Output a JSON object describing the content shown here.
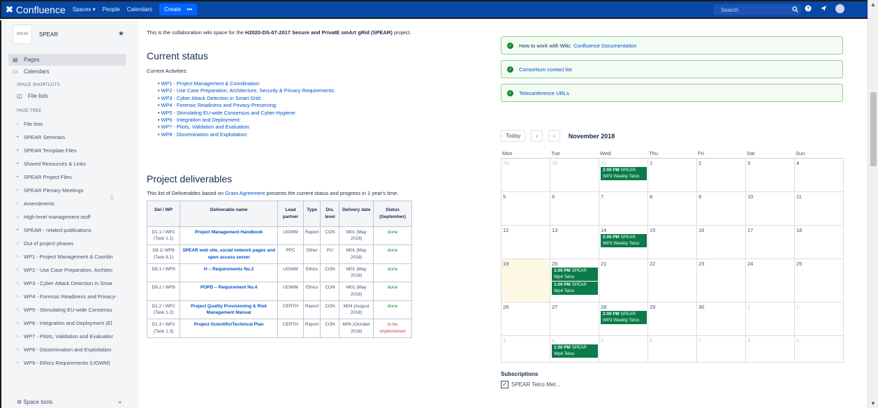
{
  "topnav": {
    "product": "Confluence",
    "items": [
      "Spaces",
      "People",
      "Calendars"
    ],
    "create_label": "Create",
    "more_label": "•••",
    "search_placeholder": "Search"
  },
  "sidebar": {
    "space_logo_text": "SPEAR",
    "space_name": "SPEAR",
    "pages_label": "Pages",
    "calendars_label": "Calendars",
    "shortcuts_header": "SPACE SHORTCUTS",
    "file_lists_shortcut": "File lists",
    "page_tree_header": "PAGE TREE",
    "tree": [
      {
        "bullet": "›",
        "label": "File lists"
      },
      {
        "bullet": "•",
        "label": "SPEAR Seminars"
      },
      {
        "bullet": "•",
        "label": "SPEAR Template Files"
      },
      {
        "bullet": "•",
        "label": "Shared Resources & Links"
      },
      {
        "bullet": "•",
        "label": "SPEAR Project Files"
      },
      {
        "bullet": "›",
        "label": "SPEAR Plenary Meetings"
      },
      {
        "bullet": "›",
        "label": "Amendments"
      },
      {
        "bullet": "›",
        "label": "High-level management stuff"
      },
      {
        "bullet": "•",
        "label": "SPEAR - related publications"
      },
      {
        "bullet": "›",
        "label": "Out of project phases"
      },
      {
        "bullet": "›",
        "label": "WP1 - Project Management & Coordin"
      },
      {
        "bullet": "›",
        "label": "WP2 - Use Case Preparation, Architec"
      },
      {
        "bullet": "›",
        "label": "WP3 - Cyber Attack Detection in Smar"
      },
      {
        "bullet": "›",
        "label": "WP4 - Forensic Readiness and Privacy-"
      },
      {
        "bullet": "›",
        "label": "WP5 - Stimulating EU-wide Consensu"
      },
      {
        "bullet": "›",
        "label": "WP6 - Integration and Deployment (El"
      },
      {
        "bullet": "›",
        "label": "WP7 - Pilots, Validation and Evaluatior"
      },
      {
        "bullet": "›",
        "label": "WP8 - Dissemination and Exploitation"
      },
      {
        "bullet": "›",
        "label": "WP9 - Ethics Requirements (UOWM)"
      }
    ],
    "space_tools_label": "Space tools",
    "collapse_label": "«"
  },
  "content": {
    "intro_prefix": "This is the collaboration wiki space for the",
    "intro_bold": "H2020-DS-07-2017 Secure and PrivatE smArt gRid (SPEAR)",
    "intro_suffix": "project.",
    "status_title": "Current status",
    "activities_label": "Current Activities:",
    "activities": [
      "WP1 - Project Management & Coordination:",
      "WP2 - Use Case Preparation, Architecture, Security & Privacy Requirements:",
      "WP3 - Cyber Attack Detection in Smart Grid:",
      "WP4 - Forensic Readiness and Privacy-Preserving:",
      "WP5 - Stimulating EU-wide Consensus and Cyber-Hygiene:",
      "WP6 - Integration and Deployment:",
      "WP7 - Pilots, Validation and Evaluation:",
      "WP8 - Dissemination and Exploitation:"
    ],
    "deliverables_title": "Project deliverables",
    "deliverables_desc_prefix": "This list of Deliverables based on",
    "deliverables_desc_link": "Grant Agreement",
    "deliverables_desc_suffix": "presents the current status and progress in 1 year's time.",
    "table_headers": [
      "Del / WP",
      "Deliverable name",
      "Lead partner",
      "Type",
      "Dis. level",
      "Delivery date",
      "Status (September)"
    ],
    "rows": [
      {
        "del": "D1.1 / WP1 (Task 1.1)",
        "name": "Project Management Handbook",
        "lead": "UOWM",
        "type": "Report",
        "dis": "CON",
        "date": "M01 (May 2018)",
        "status": "done",
        "status_class": "done"
      },
      {
        "del": "D8.1/ WP8 (Task 8.1)",
        "name": "SPEAR web site, social network pages and open access server",
        "lead": "PPC",
        "type": "Other",
        "dis": "PU",
        "date": "M01 (May 2018)",
        "status": "done",
        "status_class": "done"
      },
      {
        "del": "D9.1 / WP9",
        "name": "H – Requirements No.2",
        "lead": "UOWM",
        "type": "Ethics",
        "dis": "CON",
        "date": "M01 (May 2018)",
        "status": "done",
        "status_class": "done"
      },
      {
        "del": "D9.2 / WP9",
        "name": "POPD – Requirement No.4",
        "lead": "UOWM",
        "type": "Ethics",
        "dis": "CON",
        "date": "M01 (May 2018)",
        "status": "done",
        "status_class": "done"
      },
      {
        "del": "D1.2 / WP1 (Task 1.2)",
        "name": "Project Quality Provisioning & Risk Management Manual",
        "lead": "CERTH",
        "type": "Report",
        "dis": "CON",
        "date": "M04 (August 2018)",
        "status": "done",
        "status_class": "done"
      },
      {
        "del": "D1.3 / WP1 (Task 1.3)",
        "name": "Project Scientific/Technical Plan",
        "lead": "CERTH",
        "type": "Report",
        "dis": "CON",
        "date": "M06 (October 2018)",
        "status": "to be implemented",
        "status_class": "tbi"
      }
    ]
  },
  "info_boxes": [
    {
      "label": "How to work with Wiki:",
      "link": "Confluence Documentation"
    },
    {
      "label": "",
      "link": "Consortium contact list"
    },
    {
      "label": "",
      "link": "Teleconference URLs"
    }
  ],
  "calendar": {
    "today_label": "Today",
    "prev_label": "‹",
    "next_label": "›",
    "month_title": "November 2018",
    "weekdays": [
      "Mon",
      "Tue",
      "Wed",
      "Thu",
      "Fri",
      "Sat",
      "Sun"
    ],
    "weeks": [
      {
        "days": [
          {
            "d": "29",
            "other": true
          },
          {
            "d": "30",
            "other": true
          },
          {
            "d": "31",
            "other": true,
            "events": [
              {
                "time": "2:00 PM",
                "title": "SPEAR WP3 Weekly Telco"
              }
            ]
          },
          {
            "d": "1"
          },
          {
            "d": "2"
          },
          {
            "d": "3"
          },
          {
            "d": "4"
          }
        ]
      },
      {
        "days": [
          {
            "d": "5"
          },
          {
            "d": "6"
          },
          {
            "d": "7"
          },
          {
            "d": "8"
          },
          {
            "d": "9"
          },
          {
            "d": "10"
          },
          {
            "d": "11"
          }
        ]
      },
      {
        "days": [
          {
            "d": "12"
          },
          {
            "d": "13"
          },
          {
            "d": "14",
            "events": [
              {
                "time": "2:00 PM",
                "title": "SPEAR WP3 Weekly Telco"
              }
            ]
          },
          {
            "d": "15"
          },
          {
            "d": "16"
          },
          {
            "d": "17"
          },
          {
            "d": "18"
          }
        ]
      },
      {
        "days": [
          {
            "d": "19",
            "today": true
          },
          {
            "d": "20",
            "events": [
              {
                "time": "1:00 PM",
                "title": "SPEAR Wp4 Telco"
              },
              {
                "time": "1:00 PM",
                "title": "SPEAR Wp4 Telco"
              }
            ]
          },
          {
            "d": "21"
          },
          {
            "d": "22"
          },
          {
            "d": "23"
          },
          {
            "d": "24"
          },
          {
            "d": "25"
          }
        ]
      },
      {
        "days": [
          {
            "d": "26"
          },
          {
            "d": "27"
          },
          {
            "d": "28",
            "events": [
              {
                "time": "2:00 PM",
                "title": "SPEAR WP3 Weekly Telco"
              }
            ]
          },
          {
            "d": "29"
          },
          {
            "d": "30"
          },
          {
            "d": "1",
            "other": true
          },
          {
            "d": "2",
            "other": true
          }
        ]
      },
      {
        "days": [
          {
            "d": "3",
            "other": true
          },
          {
            "d": "4",
            "other": true,
            "events": [
              {
                "time": "1:00 PM",
                "title": "SPEAR Wp4 Telco"
              }
            ]
          },
          {
            "d": "5",
            "other": true
          },
          {
            "d": "6",
            "other": true
          },
          {
            "d": "7",
            "other": true
          },
          {
            "d": "8",
            "other": true
          },
          {
            "d": "9",
            "other": true
          }
        ]
      }
    ]
  },
  "subscriptions": {
    "title": "Subscriptions",
    "item": "SPEAR Telco Met..."
  }
}
